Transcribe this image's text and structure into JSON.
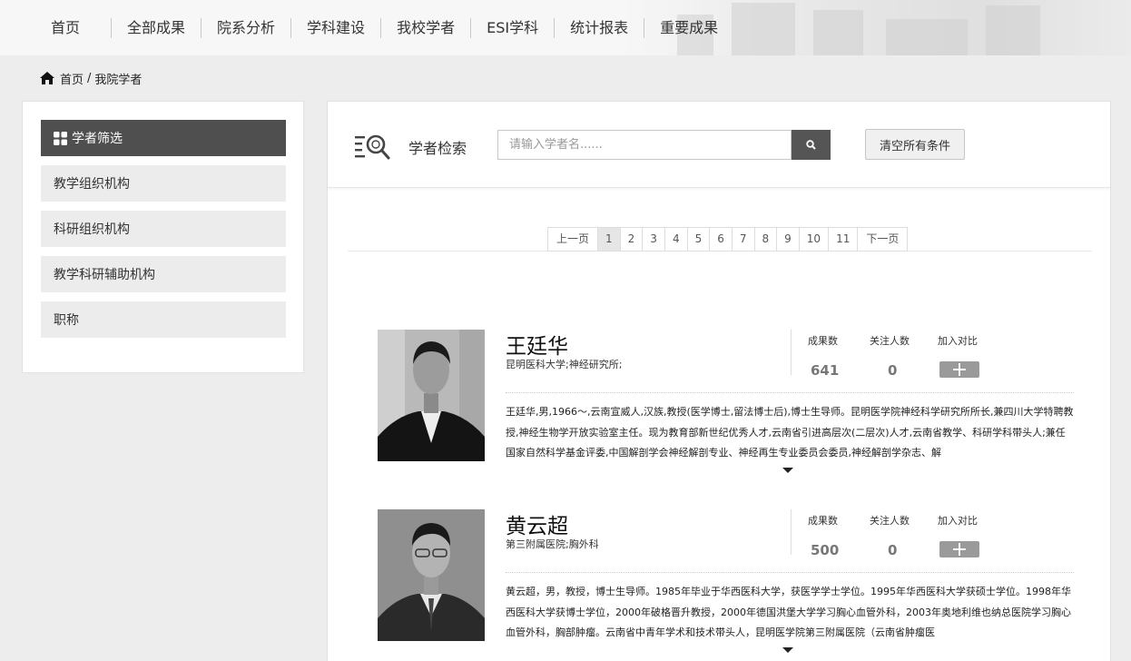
{
  "nav": {
    "items": [
      "首页",
      "全部成果",
      "院系分析",
      "学科建设",
      "我校学者",
      "ESI学科",
      "统计报表",
      "重要成果"
    ]
  },
  "breadcrumb": {
    "home": "首页",
    "sep": "/",
    "current": "我院学者"
  },
  "sidebar": {
    "header": "学者筛选",
    "items": [
      "教学组织机构",
      "科研组织机构",
      "教学科研辅助机构",
      "职称"
    ]
  },
  "search": {
    "label": "学者检索",
    "placeholder": "请输入学者名......",
    "value": "",
    "clear_label": "清空所有条件"
  },
  "pagination": {
    "prev": "上一页",
    "pages": [
      "1",
      "2",
      "3",
      "4",
      "5",
      "6",
      "7",
      "8",
      "9",
      "10",
      "11"
    ],
    "next": "下一页",
    "current": "1"
  },
  "stats_headers": {
    "results": "成果数",
    "followers": "关注人数",
    "compare": "加入对比"
  },
  "scholars": [
    {
      "name": "王廷华",
      "affiliation": "昆明医科大学;神经研究所;",
      "results": "641",
      "followers": "0",
      "bio": "王廷华,男,1966～,云南宣威人,汉族,教授(医学博士,留法博士后),博士生导师。昆明医学院神经科学研究所所长,兼四川大学特聘教授,神经生物学开放实验室主任。现为教育部新世纪优秀人才,云南省引进高层次(二层次)人才,云南省教学、科研学科带头人;兼任国家自然科学基金评委,中国解剖学会神经解剖专业、神经再生专业委员会委员,神经解剖学杂志、解"
    },
    {
      "name": "黄云超",
      "affiliation": "第三附属医院;胸外科",
      "results": "500",
      "followers": "0",
      "bio": "黄云超，男，教授，博士生导师。1985年毕业于华西医科大学，获医学学士学位。1995年华西医科大学获硕士学位。1998年华西医科大学获博士学位，2000年破格晋升教授，2000年德国洪堡大学学习胸心血管外科，2003年奥地利维也纳总医院学习胸心血管外科，胸部肿瘤。云南省中青年学术和技术带头人，昆明医学院第三附属医院（云南省肿瘤医"
    }
  ]
}
